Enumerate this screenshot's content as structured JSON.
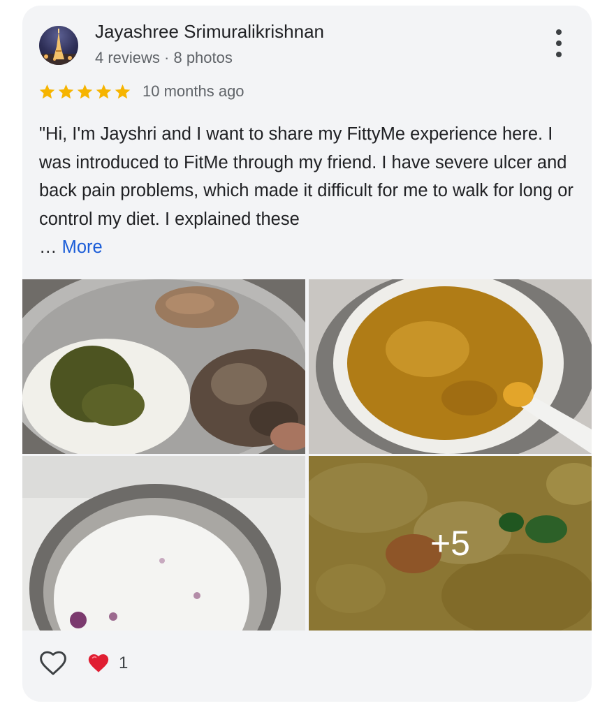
{
  "review": {
    "author_name": "Jayashree Srimuralikrishnan",
    "author_meta": "4 reviews · 8 photos",
    "rating": 5,
    "time_ago": "10 months ago",
    "text": "\"Hi, I'm Jayshri and I want to share my FittyMe experience here. I was introduced to FitMe through my friend. I have severe ulcer and back pain problems, which made it difficult for me to walk for long or control my diet. I explained these",
    "ellipsis": "…",
    "more_label": "More"
  },
  "photos": [
    {
      "icon": "photo-rice-and-curry"
    },
    {
      "icon": "photo-soup-bowl"
    },
    {
      "icon": "photo-buttermilk-vessel"
    },
    {
      "icon": "photo-egg-stir-fry",
      "more_count_label": "+5"
    }
  ],
  "reactions": {
    "like_icon": "heart-outline-icon",
    "reaction_icon": "red-heart-icon",
    "count": "1"
  },
  "colors": {
    "star": "#f6b400",
    "link": "#1a5cd8",
    "card_background": "#f3f4f6",
    "heart": "#e01e32"
  }
}
